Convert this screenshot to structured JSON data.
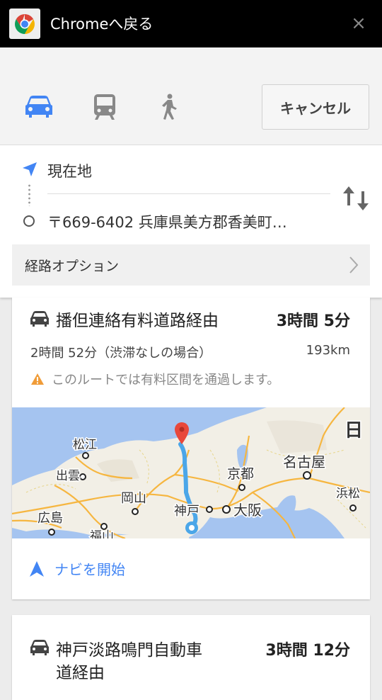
{
  "topbar": {
    "title": "Chromeへ戻る",
    "close": "×"
  },
  "modes": {
    "cancel_label": "キャンセル",
    "selected": "car"
  },
  "route": {
    "origin": "現在地",
    "destination": "〒669-6402 兵庫県美方郡香美町…",
    "options_label": "経路オプション"
  },
  "cards": [
    {
      "title": "播但連絡有料道路経由",
      "duration": "3時間 5分",
      "subtitle": "2時間 52分（渋滞なしの場合）",
      "distance": "193km",
      "warning": "このルートでは有料区間を通過します。",
      "nav_label": "ナビを開始",
      "map_labels": [
        "松江",
        "出雲",
        "岡山",
        "広島",
        "福山",
        "神戸",
        "大阪",
        "京都",
        "名古屋",
        "浜松",
        "日"
      ]
    },
    {
      "title_line1": "神戸淡路鳴門自動車",
      "title_line2": "道経由",
      "duration": "3時間 12分"
    }
  ],
  "colors": {
    "accent": "#4285f4",
    "route": "#4ba6e8",
    "map_land": "#f2efe6",
    "map_sea": "#a5c4f0",
    "warning": "#f09c38"
  }
}
